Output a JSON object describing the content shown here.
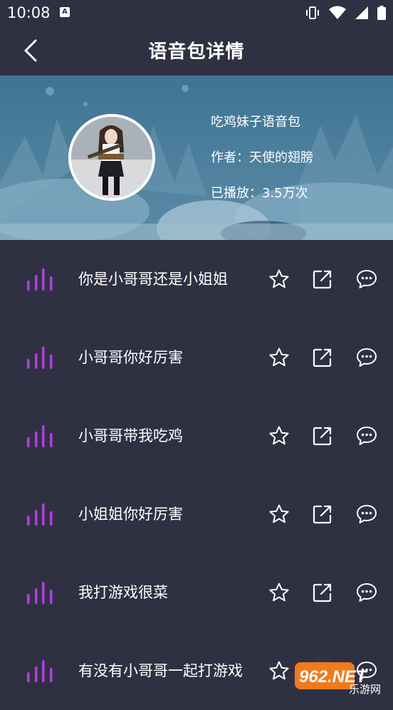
{
  "status_bar": {
    "time": "10:08"
  },
  "header": {
    "title": "语音包详情"
  },
  "pack": {
    "name": "吃鸡妹子语音包",
    "author": "作者：天使的翅膀",
    "plays": "已播放：3.5万次"
  },
  "clips": [
    {
      "title": "你是小哥哥还是小姐姐"
    },
    {
      "title": "小哥哥你好厉害"
    },
    {
      "title": "小哥哥带我吃鸡"
    },
    {
      "title": "小姐姐你好厉害"
    },
    {
      "title": "我打游戏很菜"
    },
    {
      "title": "有没有小哥哥一起打游戏"
    }
  ],
  "watermark": {
    "text": "962.NET",
    "subtext": "乐游网"
  },
  "colors": {
    "background": "#2f3142",
    "wave_accent": "#b23ee0",
    "banner": "#3b6f8d"
  }
}
